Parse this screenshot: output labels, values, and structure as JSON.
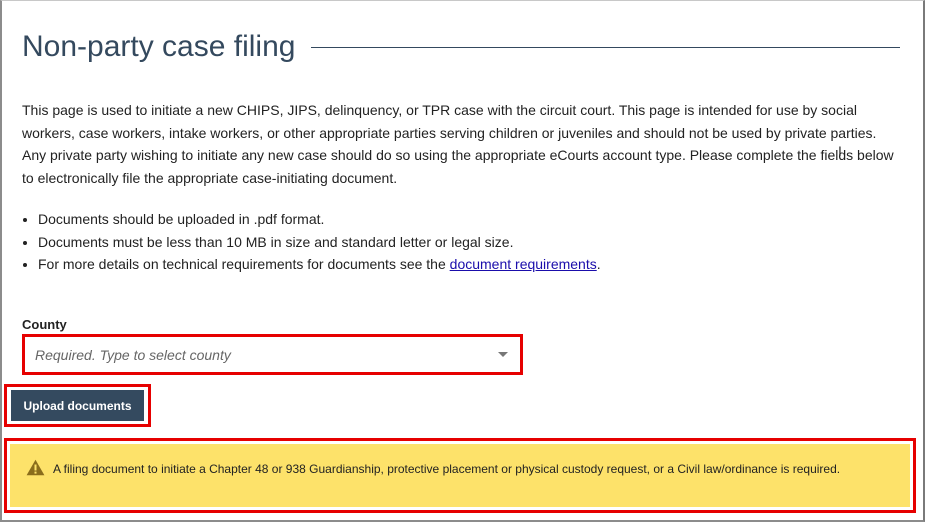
{
  "page": {
    "title": "Non-party case filing",
    "intro": "This page is used to initiate a new CHIPS, JIPS, delinquency, or TPR case with the circuit court. This page is intended for use by social workers, case workers, intake workers, or other appropriate parties serving children or juveniles and should not be used by private parties. Any private party wishing to initiate any new case should do so using the appropriate eCourts account type. Please complete the fields below to electronically file the appropriate case-initiating document."
  },
  "requirements": {
    "items": [
      "Documents should be uploaded in .pdf format.",
      "Documents must be less than 10 MB in size and standard letter or legal size."
    ],
    "details_prefix": "For more details on technical requirements for documents see the ",
    "details_link": "document requirements",
    "details_suffix": "."
  },
  "county": {
    "label": "County",
    "placeholder": "Required. Type to select county"
  },
  "actions": {
    "upload_label": "Upload documents"
  },
  "alert": {
    "message": "A filing document to initiate a Chapter 48 or 938 Guardianship, protective placement or physical custody request, or a Civil law/ordinance is required."
  },
  "colors": {
    "accent": "#344a5f",
    "highlight": "#e60000",
    "alert_background": "#fde26a",
    "warning_icon": "#8a6d1b"
  },
  "icons": {
    "dropdown": "chevron-down-icon",
    "alert": "warning-icon"
  }
}
